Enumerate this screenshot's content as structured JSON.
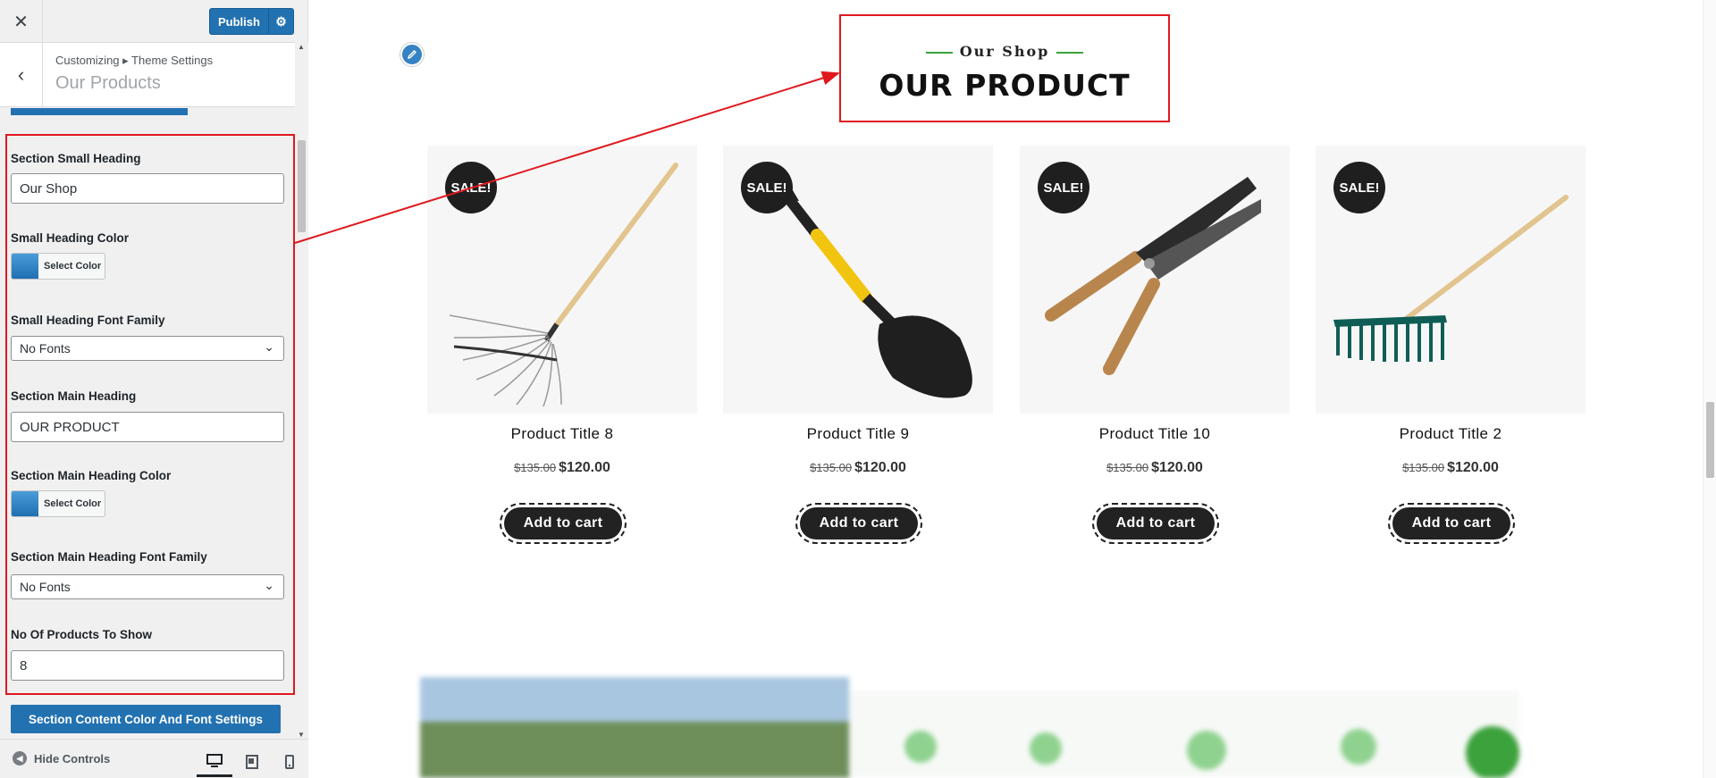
{
  "header": {
    "close_icon": "close-icon",
    "publish_label": "Publish",
    "publish_gear_icon": "gear-icon"
  },
  "titlebar": {
    "breadcrumb": "Customizing ▸ Theme Settings",
    "title": "Our Products"
  },
  "controls": {
    "small_heading": {
      "label": "Section Small Heading",
      "value": "Our Shop"
    },
    "small_heading_color": {
      "label": "Small Heading Color",
      "button": "Select Color",
      "swatch": "#2f87c9"
    },
    "small_heading_font": {
      "label": "Small Heading Font Family",
      "value": "No Fonts"
    },
    "main_heading": {
      "label": "Section Main Heading",
      "value": "OUR PRODUCT"
    },
    "main_heading_color": {
      "label": "Section Main Heading Color",
      "button": "Select Color",
      "swatch": "#2f87c9"
    },
    "main_heading_font": {
      "label": "Section Main Heading Font Family",
      "value": "No Fonts"
    },
    "num_products": {
      "label": "No Of Products To Show",
      "value": "8"
    },
    "content_settings_button": "Section Content Color And Font Settings"
  },
  "footer": {
    "hide_controls": "Hide Controls",
    "devices": [
      "desktop",
      "tablet",
      "mobile"
    ]
  },
  "preview": {
    "small_heading": "Our Shop",
    "main_heading": "OUR PRODUCT",
    "accent_color": "#3ca23c",
    "highlight_color": "#e0181e",
    "products": [
      {
        "title": "Product Title 8",
        "old_price": "$135.00",
        "price": "$120.00",
        "badge": "SALE!",
        "cart": "Add to cart",
        "image": "leaf-rake"
      },
      {
        "title": "Product Title 9",
        "old_price": "$135.00",
        "price": "$120.00",
        "badge": "SALE!",
        "cart": "Add to cart",
        "image": "shovel"
      },
      {
        "title": "Product Title 10",
        "old_price": "$135.00",
        "price": "$120.00",
        "badge": "SALE!",
        "cart": "Add to cart",
        "image": "hedge-shears"
      },
      {
        "title": "Product Title 2",
        "old_price": "$135.00",
        "price": "$120.00",
        "badge": "SALE!",
        "cart": "Add to cart",
        "image": "garden-rake"
      }
    ]
  }
}
